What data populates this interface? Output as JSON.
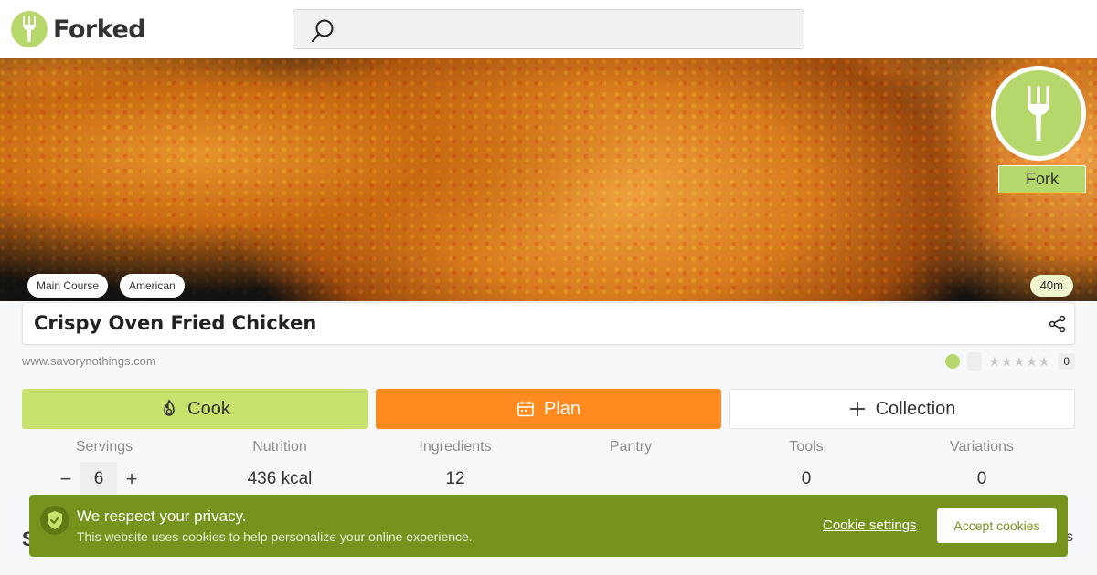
{
  "header": {
    "logo_text": "Forked",
    "search": {
      "placeholder": ""
    }
  },
  "hero": {
    "fork_label": "Fork",
    "tags": [
      "Main Course",
      "American"
    ],
    "time": "40m"
  },
  "recipe": {
    "title": "Crispy Oven Fried Chicken",
    "source": "www.savorynothings.com",
    "rating_count": "0",
    "stars": "★★★★★"
  },
  "actions": {
    "cook": "Cook",
    "plan": "Plan",
    "collection": "Collection"
  },
  "stats": {
    "servings": {
      "label": "Servings",
      "value": "6",
      "minus": "−",
      "plus": "+"
    },
    "nutrition": {
      "label": "Nutrition",
      "value": "436 kcal"
    },
    "ingredients": {
      "label": "Ingredients",
      "value": "12"
    },
    "pantry": {
      "label": "Pantry",
      "value": ""
    },
    "tools": {
      "label": "Tools",
      "value": "0"
    },
    "variations": {
      "label": "Variations",
      "value": "0"
    }
  },
  "partially_hidden": {
    "left": "S",
    "right": "s"
  },
  "cookie": {
    "title": "We respect your privacy.",
    "text": "This website uses cookies to help personalize your online experience.",
    "settings": "Cookie settings",
    "accept": "Accept cookies"
  },
  "colors": {
    "brand_green": "#b5d76b",
    "cook_green": "#c7e36d",
    "plan_orange": "#ff8a1f",
    "cookie_green": "#76941d"
  },
  "icons": [
    "fork-icon",
    "search-icon",
    "share-icon",
    "flame-icon",
    "calendar-icon",
    "plus-icon",
    "shield-check-icon",
    "leaf-icon"
  ]
}
